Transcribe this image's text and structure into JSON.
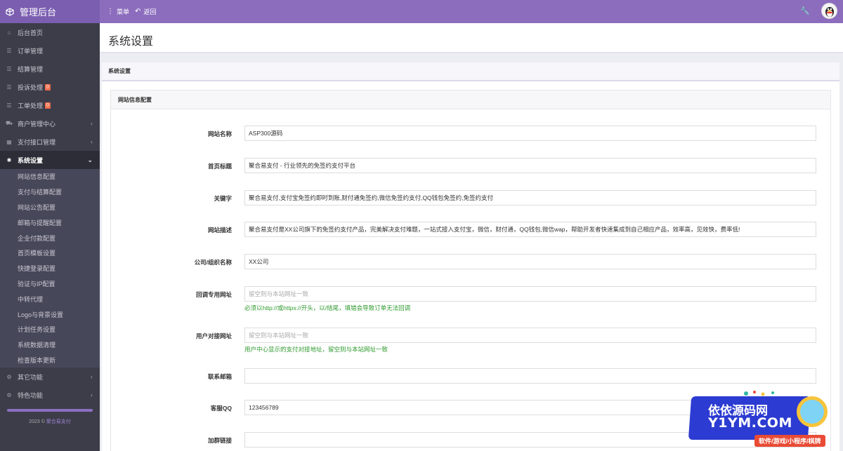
{
  "header": {
    "brand": "管理后台",
    "menu_label": "菜单",
    "back_label": "返回"
  },
  "sidebar": {
    "items": [
      {
        "label": "后台首页"
      },
      {
        "label": "订单管理"
      },
      {
        "label": "结算管理"
      },
      {
        "label": "投诉处理",
        "badge": "0"
      },
      {
        "label": "工单处理",
        "badge": "0"
      },
      {
        "label": "商户管理中心"
      },
      {
        "label": "支付接口管理"
      },
      {
        "label": "系统设置"
      }
    ],
    "submenu": [
      "网站信息配置",
      "支付与结算配置",
      "网站公告配置",
      "邮箱与提醒配置",
      "企业付款配置",
      "首页模板设置",
      "快捷登录配置",
      "验证与IP配置",
      "中转代理",
      "Logo与背景设置",
      "计划任务设置",
      "系统数据清理",
      "检查版本更新"
    ],
    "bottom_items": [
      {
        "label": "其它功能"
      },
      {
        "label": "特色功能"
      }
    ],
    "footer_year": "2023 ©",
    "footer_link": "聚合易支付"
  },
  "page": {
    "title": "系统设置",
    "panel_title": "系统设置",
    "section_title": "网站信息配置"
  },
  "form": {
    "site_name": {
      "label": "网站名称",
      "value": "ASP300源码"
    },
    "home_title": {
      "label": "首页标题",
      "value": "聚合易支付 - 行业领先的免签约支付平台"
    },
    "keywords": {
      "label": "关键字",
      "value": "聚合易支付,支付宝免签约即时到账,财付通免签约,微信免签约支付,QQ钱包免签约,免签约支付"
    },
    "description": {
      "label": "网站描述",
      "value": "聚合易支付是XX公司旗下的免签约支付产品，完美解决支付难题，一站式接入支付宝，微信，财付通，QQ钱包,微信wap，帮助开发者快速集成到自己相应产品，效率高，见效快，费率低!"
    },
    "company": {
      "label": "公司/组织名称",
      "value": "XX公司"
    },
    "callback_url": {
      "label": "回调专用网址",
      "placeholder": "留空则与本站网址一致",
      "help": "必须以http://或https://开头，以/结尾，填错会导致订单无法回调"
    },
    "user_api_url": {
      "label": "用户对接网址",
      "placeholder": "留空则与本站网址一致",
      "help": "用户中心显示的支付对接地址，留空则与本站网址一致"
    },
    "email": {
      "label": "联系邮箱",
      "value": ""
    },
    "qq": {
      "label": "客服QQ",
      "value": "123456789"
    },
    "group_link": {
      "label": "加群链接",
      "value": ""
    }
  },
  "watermark": {
    "line1": "依依源码网",
    "line2": "Y1YM.COM",
    "tag": "软件/游戏/小程序/棋牌"
  },
  "colors": {
    "topbar": "#8c6dbd",
    "sidebar": "#3d3d4a",
    "help_text": "#2f9a2f",
    "badge": "#ef6c4d"
  }
}
